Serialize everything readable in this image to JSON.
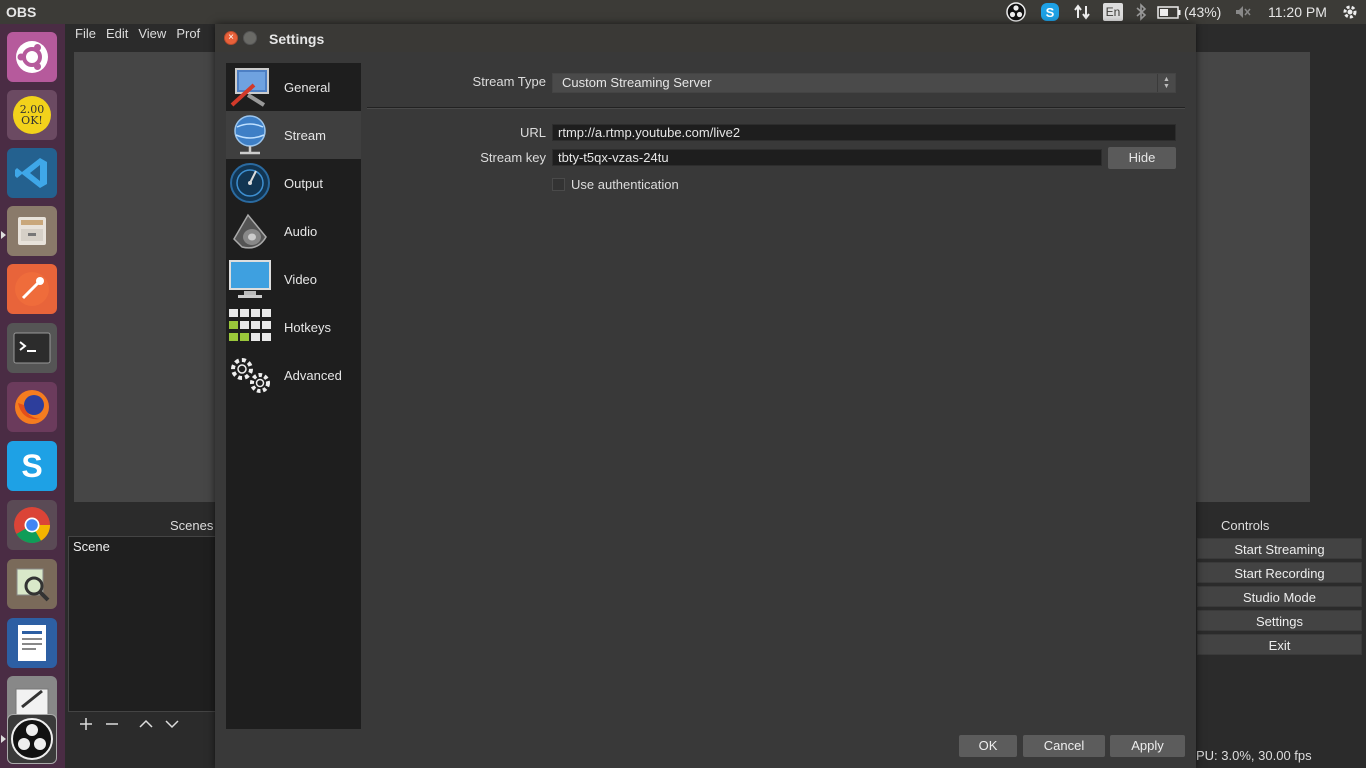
{
  "topbar": {
    "app_name": "OBS",
    "language": "En",
    "battery": "(43%)",
    "clock": "11:20 PM"
  },
  "launcher": {
    "items": [
      {
        "name": "ubuntu-dash"
      },
      {
        "name": "sticky-note",
        "label": "2.00 OK!"
      },
      {
        "name": "vscode"
      },
      {
        "name": "files"
      },
      {
        "name": "postman"
      },
      {
        "name": "terminal"
      },
      {
        "name": "firefox"
      },
      {
        "name": "skype"
      },
      {
        "name": "chrome"
      },
      {
        "name": "image-viewer"
      },
      {
        "name": "writer"
      },
      {
        "name": "text-editor"
      },
      {
        "name": "obs"
      }
    ]
  },
  "obs_main": {
    "menu": [
      "File",
      "Edit",
      "View",
      "Prof"
    ],
    "scenes_title": "Scenes",
    "scene_item": "Scene",
    "controls_title": "Controls",
    "controls": [
      "Start Streaming",
      "Start Recording",
      "Studio Mode",
      "Settings",
      "Exit"
    ],
    "status": "PU: 3.0%, 30.00 fps"
  },
  "settings": {
    "title": "Settings",
    "close_glyph": "×",
    "sections": [
      {
        "label": "General",
        "icon": "general-icon"
      },
      {
        "label": "Stream",
        "icon": "stream-icon"
      },
      {
        "label": "Output",
        "icon": "output-icon"
      },
      {
        "label": "Audio",
        "icon": "audio-icon"
      },
      {
        "label": "Video",
        "icon": "video-icon"
      },
      {
        "label": "Hotkeys",
        "icon": "hotkeys-icon"
      },
      {
        "label": "Advanced",
        "icon": "advanced-icon"
      }
    ],
    "active_section": "Stream",
    "stream_type_label": "Stream Type",
    "stream_type_value": "Custom Streaming Server",
    "url_label": "URL",
    "url_value": "rtmp://a.rtmp.youtube.com/live2",
    "key_label": "Stream key",
    "key_value": "tbty-t5qx-vzas-24tu",
    "hide_label": "Hide",
    "auth_label": "Use authentication",
    "auth_checked": false,
    "buttons": {
      "ok": "OK",
      "cancel": "Cancel",
      "apply": "Apply"
    }
  },
  "colors": {
    "launcher_bg": "#4a2c44",
    "panel_bg": "#3c3b37",
    "dialog_bg": "#393939",
    "close_orange": "#e8613a"
  }
}
